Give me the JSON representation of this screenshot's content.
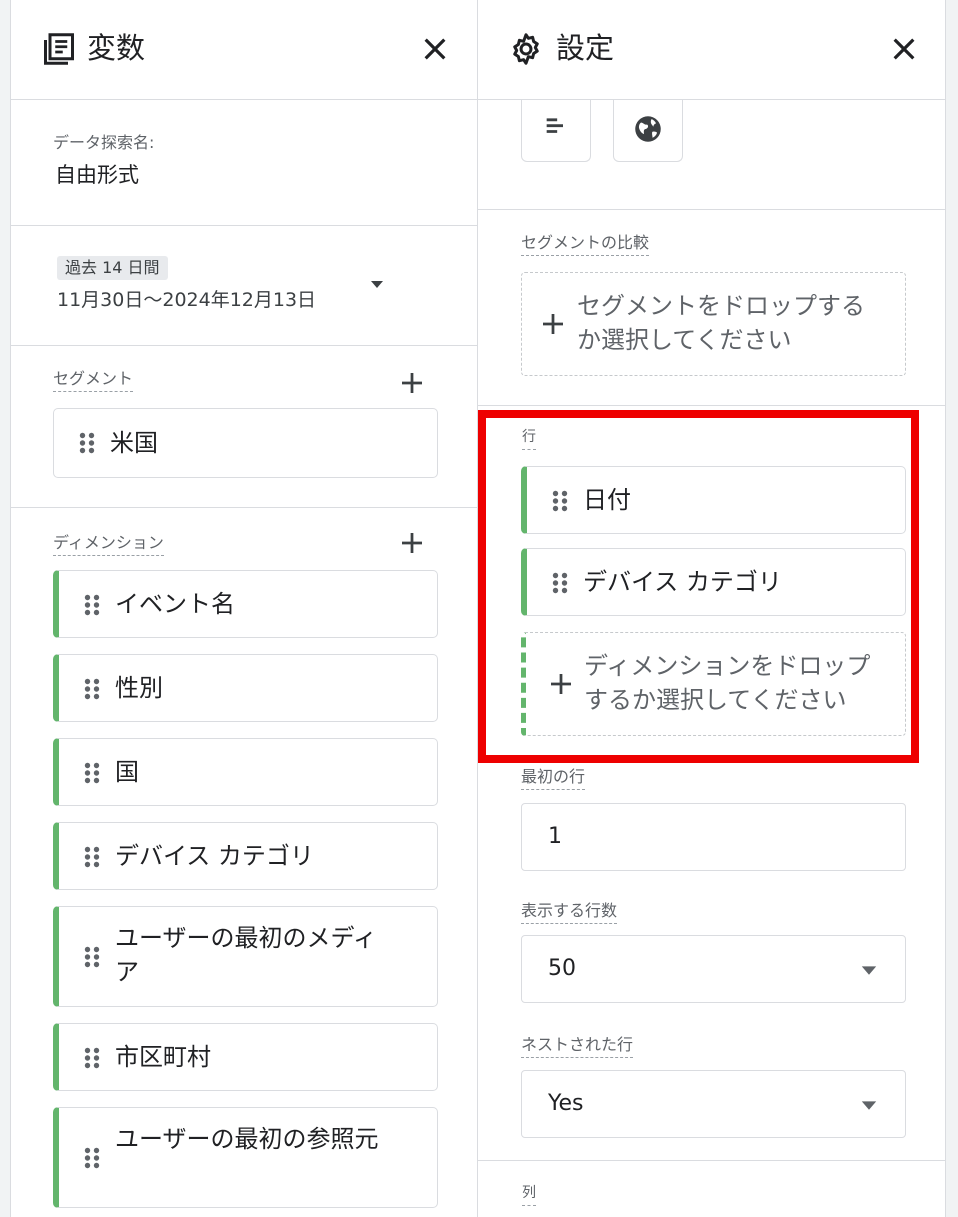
{
  "variables_panel": {
    "title": "変数",
    "exploration_name_label": "データ探索名:",
    "exploration_name": "自由形式",
    "date_range": {
      "badge": "過去 14 日間",
      "range": "11月30日～2024年12月13日"
    },
    "segments": {
      "heading": "セグメント",
      "items": [
        {
          "label": "米国"
        }
      ]
    },
    "dimensions": {
      "heading": "ディメンション",
      "items": [
        {
          "label": "イベント名"
        },
        {
          "label": "性別"
        },
        {
          "label": "国"
        },
        {
          "label": "デバイス カテゴリ"
        },
        {
          "label": "ユーザーの最初のメディア"
        },
        {
          "label": "市区町村"
        },
        {
          "label": "ユーザーの最初の参照元"
        }
      ]
    }
  },
  "settings_panel": {
    "title": "設定",
    "segment_comparison": {
      "heading": "セグメントの比較",
      "dropzone": "セグメントをドロップするか選択してください"
    },
    "rows": {
      "heading": "行",
      "items": [
        {
          "label": "日付"
        },
        {
          "label": "デバイス カテゴリ"
        }
      ],
      "dropzone": "ディメンションをドロップするか選択してください"
    },
    "start_row": {
      "heading": "最初の行",
      "value": "1"
    },
    "show_rows": {
      "heading": "表示する行数",
      "value": "50"
    },
    "nested_rows": {
      "heading": "ネストされた行",
      "value": "Yes"
    },
    "columns": {
      "heading": "列"
    }
  },
  "colors": {
    "accent_green": "#63b56c",
    "highlight_red": "#ee0000"
  }
}
